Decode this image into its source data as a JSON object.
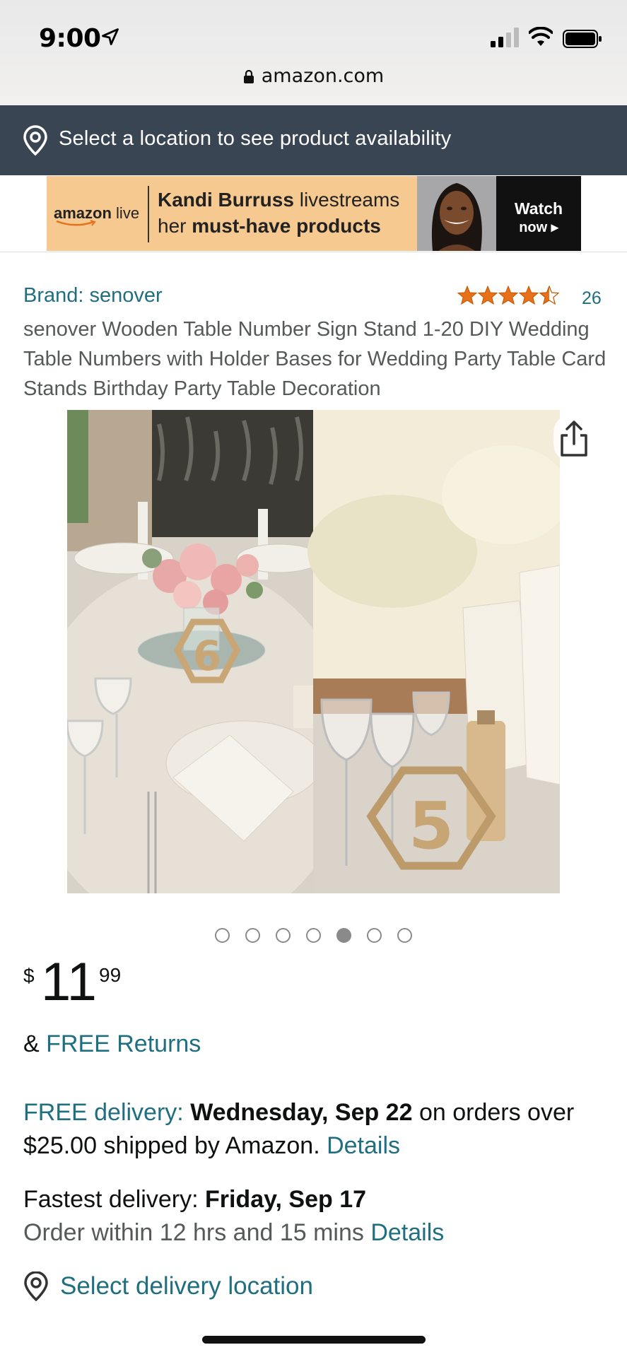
{
  "status_bar": {
    "time": "9:00",
    "icons": [
      "location-arrow-icon",
      "signal-icon",
      "wifi-icon",
      "battery-icon"
    ]
  },
  "browser": {
    "url": "amazon.com",
    "lock_icon": "lock-icon"
  },
  "location_bar": {
    "icon": "location-pin-icon",
    "text": "Select a location to see product availability",
    "bg_color": "#3a4553"
  },
  "ad_banner": {
    "logo_word": "amazon",
    "logo_suffix": "live",
    "line1_bold": "Kandi Burruss",
    "line1_rest": " livestreams",
    "line2_plain": "her ",
    "line2_bold": "must-have products",
    "cta_line1": "Watch",
    "cta_line2": "now ▸"
  },
  "product": {
    "brand": "Brand: senover",
    "rating_stars": 4.5,
    "rating_count": "26",
    "title": "senover Wooden Table Number Sign Stand 1-20 DIY Wedding Table Numbers with Holder Bases for Wedding Party Table Card Stands Birthday Party Table Decoration",
    "image_count": 7,
    "active_image_index": 4
  },
  "price": {
    "symbol": "$",
    "whole": "11",
    "fraction": "99"
  },
  "returns": {
    "prefix": "& ",
    "link": "FREE Returns"
  },
  "delivery": {
    "free_label": "FREE delivery:",
    "free_date": "Wednesday, Sep 22",
    "free_rest": " on orders over $25.00 shipped by Amazon. ",
    "free_details": "Details",
    "fast_label": "Fastest delivery: ",
    "fast_date": "Friday, Sep 17",
    "order_within": "Order within 12 hrs and 15 mins ",
    "order_details": "Details",
    "select_location": "Select delivery location"
  },
  "colors": {
    "link": "#1f6f80",
    "star": "#e7711b",
    "ad_bg": "#f5c990"
  }
}
